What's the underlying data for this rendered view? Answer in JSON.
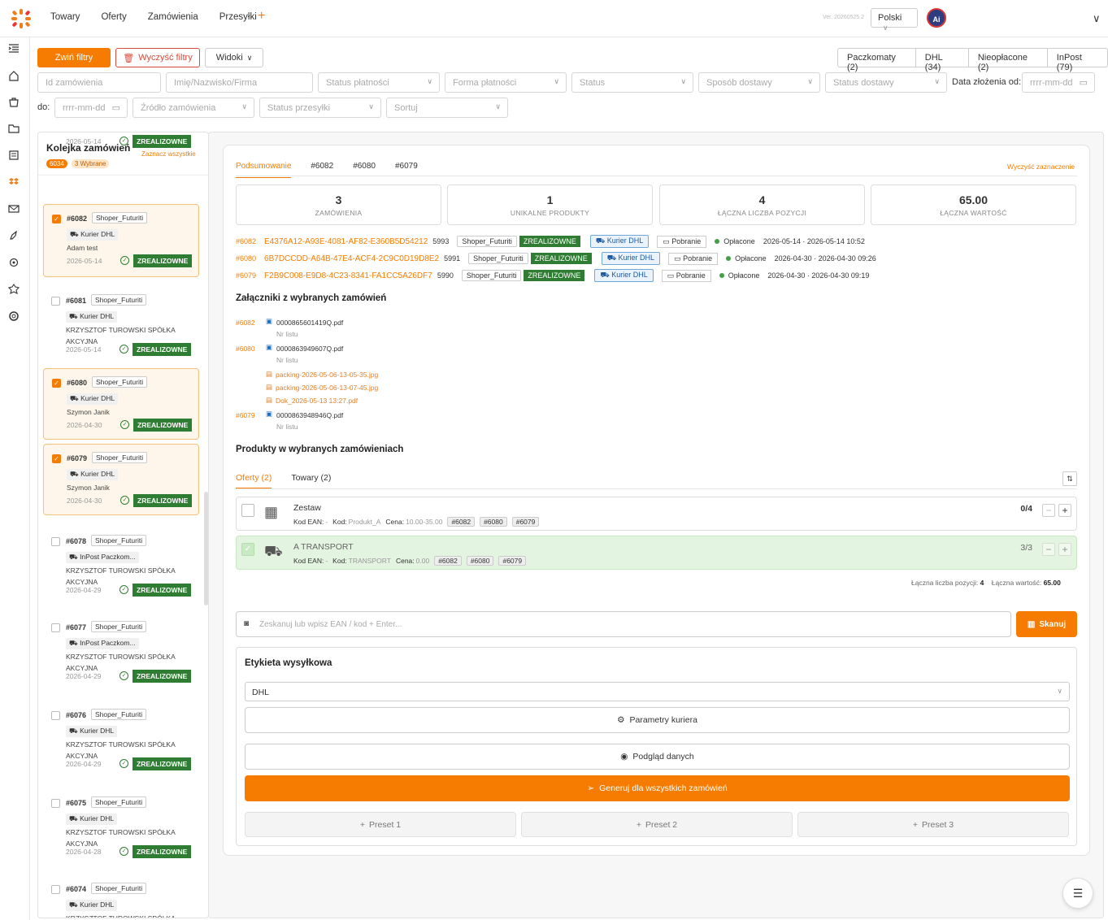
{
  "topbar": {
    "nav": [
      "Towary",
      "Oferty",
      "Zamówienia",
      "Przesyłki"
    ],
    "version": "Ver. 20260525.2",
    "language": "Polski",
    "avatar_text": "Ai"
  },
  "toolbar": {
    "collapse_filters": "Zwiń filtry",
    "clear_filters": "Wyczyść filtry",
    "views": "Widoki",
    "quick_tabs": [
      "Paczkomaty (2)",
      "DHL (34)",
      "Nieopłacone (2)",
      "InPost (79)"
    ]
  },
  "filters": {
    "order_id": "Id zamówienia",
    "name": "Imię/Nazwisko/Firma",
    "payment_status": "Status płatności",
    "payment_form": "Forma płatności",
    "status": "Status",
    "delivery_method": "Sposób dostawy",
    "delivery_status": "Status dostawy",
    "date_from_label": "Data złożenia od:",
    "date_placeholder": "rrrr-mm-dd",
    "date_to_label": "do:",
    "source": "Źródło zamówienia",
    "shipment_status": "Status przesyłki",
    "sort": "Sortuj"
  },
  "queue": {
    "title": "Kolejka zamówień",
    "select_all": "Zaznacz wszystkie",
    "count": "6034",
    "selected": "3 Wybrane",
    "items": [
      {
        "id": "",
        "date": "2026-05-14",
        "status": "ZREALIZOWNE",
        "checked": false
      },
      {
        "id": "#6082",
        "shop": "Shoper_Futuriti",
        "carrier": "Kurier DHL",
        "name": "Adam test",
        "date": "2026-05-14",
        "status": "ZREALIZOWNE",
        "checked": true
      },
      {
        "id": "#6081",
        "shop": "Shoper_Futuriti",
        "carrier": "Kurier DHL",
        "name": "KRZYSZTOF TUROWSKI SPÓŁKA AKCYJNA",
        "date": "2026-05-14",
        "status": "ZREALIZOWNE",
        "checked": false
      },
      {
        "id": "#6080",
        "shop": "Shoper_Futuriti",
        "carrier": "Kurier DHL",
        "name": "Szymon Janik",
        "date": "2026-04-30",
        "status": "ZREALIZOWNE",
        "checked": true
      },
      {
        "id": "#6079",
        "shop": "Shoper_Futuriti",
        "carrier": "Kurier DHL",
        "name": "Szymon Janik",
        "date": "2026-04-30",
        "status": "ZREALIZOWNE",
        "checked": true
      },
      {
        "id": "#6078",
        "shop": "Shoper_Futuriti",
        "carrier": "InPost Paczkom...",
        "name": "KRZYSZTOF TUROWSKI SPÓŁKA AKCYJNA",
        "date": "2026-04-29",
        "status": "ZREALIZOWNE",
        "checked": false
      },
      {
        "id": "#6077",
        "shop": "Shoper_Futuriti",
        "carrier": "InPost Paczkom...",
        "name": "KRZYSZTOF TUROWSKI SPÓŁKA AKCYJNA",
        "date": "2026-04-29",
        "status": "ZREALIZOWNE",
        "checked": false
      },
      {
        "id": "#6076",
        "shop": "Shoper_Futuriti",
        "carrier": "Kurier DHL",
        "name": "KRZYSZTOF TUROWSKI SPÓŁKA AKCYJNA",
        "date": "2026-04-29",
        "status": "ZREALIZOWNE",
        "checked": false
      },
      {
        "id": "#6075",
        "shop": "Shoper_Futuriti",
        "carrier": "Kurier DHL",
        "name": "KRZYSZTOF TUROWSKI SPÓŁKA AKCYJNA",
        "date": "2026-04-28",
        "status": "ZREALIZOWNE",
        "checked": false
      },
      {
        "id": "#6074",
        "shop": "Shoper_Futuriti",
        "carrier": "Kurier DHL",
        "name": "KRZYSZTOF TUROWSKI SPÓŁKA",
        "date": "",
        "status": "",
        "checked": false
      }
    ]
  },
  "summary": {
    "tabs": [
      "Podsumowanie",
      "#6082",
      "#6080",
      "#6079"
    ],
    "clear_selection": "Wyczyść zaznaczenie",
    "stats": [
      {
        "value": "3",
        "label": "ZAMÓWIENIA"
      },
      {
        "value": "1",
        "label": "UNIKALNE PRODUKTY"
      },
      {
        "value": "4",
        "label": "ŁĄCZNA LICZBA POZYCJI"
      },
      {
        "value": "65.00",
        "label": "ŁĄCZNA WARTOŚĆ"
      }
    ],
    "orders": [
      {
        "id": "#6082",
        "uuid": "E4376A12-A93E-4081-AF82-E360B5D54212",
        "num": "5993",
        "shop": "Shoper_Futuriti",
        "status": "ZREALIZOWNE",
        "carrier": "Kurier DHL",
        "payment": "Pobranie",
        "paid": "Opłacone",
        "dates": "2026-05-14 · 2026-05-14 10:52"
      },
      {
        "id": "#6080",
        "uuid": "6B7DCCDD-A64B-47E4-ACF4-2C9C0D19D8E2",
        "num": "5991",
        "shop": "Shoper_Futuriti",
        "status": "ZREALIZOWNE",
        "carrier": "Kurier DHL",
        "payment": "Pobranie",
        "paid": "Opłacone",
        "dates": "2026-04-30 · 2026-04-30 09:26"
      },
      {
        "id": "#6079",
        "uuid": "F2B9C008-E9D8-4C23-8341-FA1CC5A26DF7",
        "num": "5990",
        "shop": "Shoper_Futuriti",
        "status": "ZREALIZOWNE",
        "carrier": "Kurier DHL",
        "payment": "Pobranie",
        "paid": "Opłacone",
        "dates": "2026-04-30 · 2026-04-30 09:19"
      }
    ]
  },
  "attachments": {
    "title": "Załączniki z wybranych zamówień",
    "groups": [
      {
        "id": "#6082",
        "file": "0000865601419Q.pdf",
        "sub": "Nr listu",
        "extra": []
      },
      {
        "id": "#6080",
        "file": "0000863949607Q.pdf",
        "sub": "Nr listu",
        "extra": [
          "packing-2026-05-06-13-05-35.jpg",
          "packing-2026-05-06-13-07-45.jpg",
          "Dok_2026-05-13 13:27.pdf"
        ]
      },
      {
        "id": "#6079",
        "file": "0000863948946Q.pdf",
        "sub": "Nr listu",
        "extra": []
      }
    ]
  },
  "products": {
    "title": "Produkty w wybranych zamówieniach",
    "tabs": [
      "Oferty (2)",
      "Towary (2)"
    ],
    "rows": [
      {
        "name": "Zestaw",
        "ean_label": "Kod EAN:",
        "ean": "-",
        "code_label": "Kod:",
        "code": "Produkt_A",
        "price_label": "Cena:",
        "price": "10.00-35.00",
        "orders": [
          "#6082",
          "#6080",
          "#6079"
        ],
        "count": "0/4",
        "done": false
      },
      {
        "name": "A TRANSPORT",
        "ean_label": "Kod EAN:",
        "ean": "-",
        "code_label": "Kod:",
        "code": "TRANSPORT",
        "price_label": "Cena:",
        "price": "0.00",
        "orders": [
          "#6082",
          "#6080",
          "#6079"
        ],
        "count": "3/3",
        "done": true
      }
    ],
    "total_items_label": "Łączna liczba pozycji:",
    "total_items": "4",
    "total_value_label": "Łączna wartość:",
    "total_value": "65.00"
  },
  "scan": {
    "placeholder": "Zeskanuj lub wpisz EAN / kod + Enter...",
    "button": "Skanuj"
  },
  "label": {
    "title": "Etykieta wysyłkowa",
    "carrier": "DHL",
    "params": "Parametry kuriera",
    "preview": "Podgląd danych",
    "generate": "Generuj dla wszystkich zamówień",
    "presets": [
      "Preset 1",
      "Preset 2",
      "Preset 3"
    ]
  },
  "colors": {
    "accent": "#f57c00",
    "success": "#2e7d32",
    "danger": "#d94b3a"
  }
}
